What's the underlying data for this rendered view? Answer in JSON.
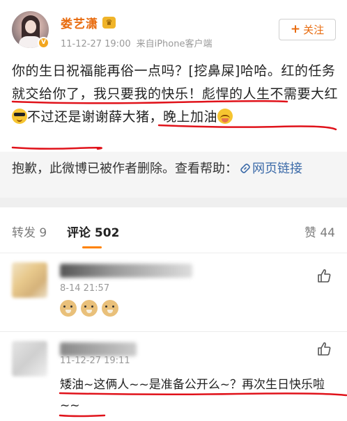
{
  "post": {
    "author": "娄艺潇",
    "verified_badge": "V",
    "crown_icon": "crown-icon",
    "time": "11-12-27 19:00",
    "source": "来自iPhone客户端",
    "follow_label": "关注",
    "content_segments": [
      "你的生日祝福能再俗一点吗？[挖鼻屎]哈哈。红的任务就交给你了，我只要我的快乐！彪悍的人生不需要大红",
      "不过还是谢谢薛大猪，晚上加油"
    ],
    "emoji_names": [
      "cool-face-icon",
      "shy-face-icon"
    ]
  },
  "deleted_notice": {
    "text": "抱歉，此微博已被作者删除。查看帮助：",
    "link_label": "网页链接"
  },
  "tabs": {
    "repost": "转发 9",
    "comments": "评论 502",
    "likes": "赞 44",
    "accent_color": "#ff8200"
  },
  "comments": [
    {
      "time": "8-14 21:57",
      "emoji_count": 3,
      "emoji_name": "doge-icon"
    },
    {
      "time": "11-12-27 19:11",
      "text": "矮油~这俩人~~是准备公开么~？再次生日快乐啦~~"
    }
  ],
  "colors": {
    "author": "#e86b0e",
    "underline": "#e0121a",
    "link": "#3b6aa8"
  }
}
